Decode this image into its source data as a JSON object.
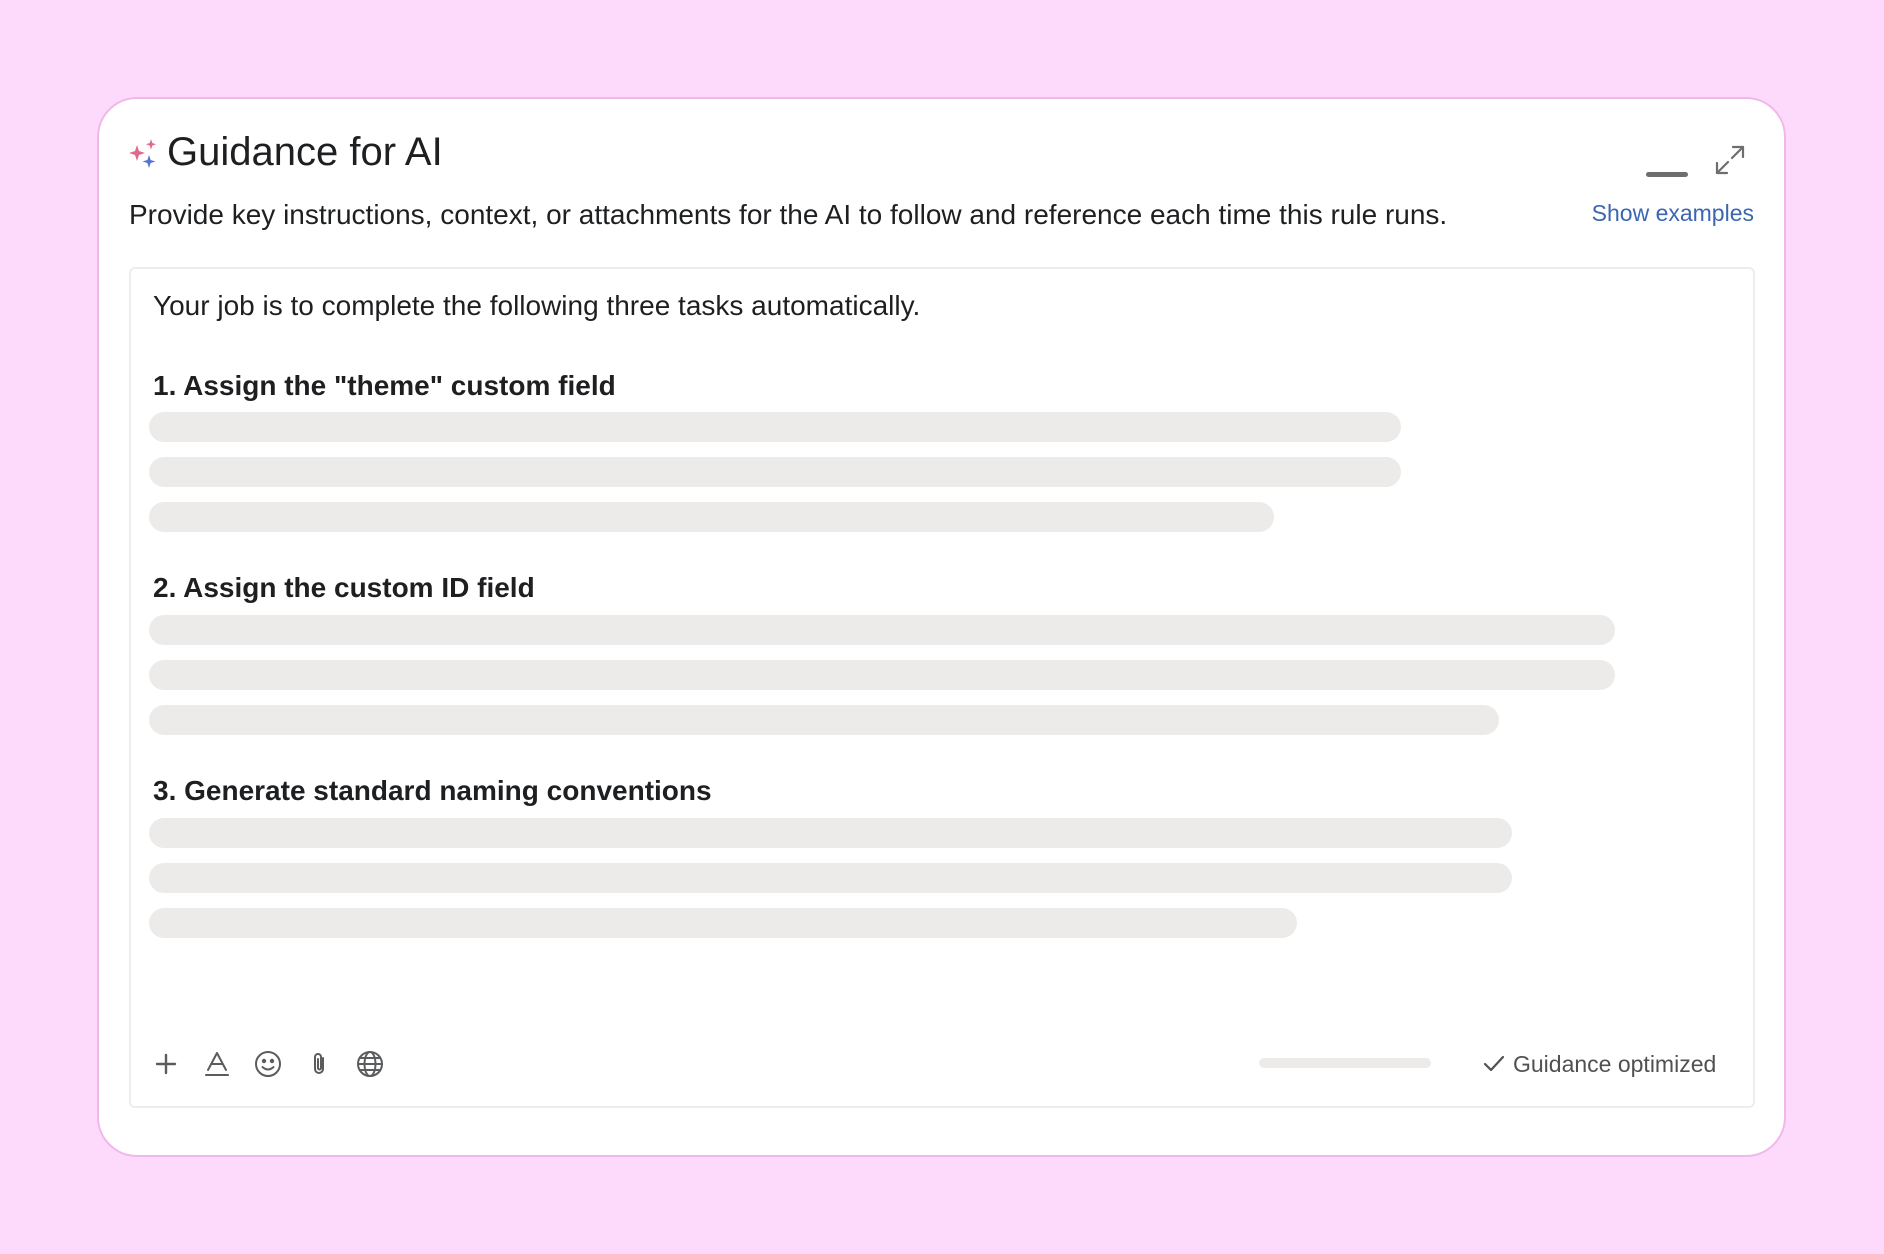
{
  "panel": {
    "title": "Guidance for AI",
    "subtitle": "Provide key instructions, context, or attachments for the AI to follow and reference each time this rule runs.",
    "show_examples_label": "Show examples",
    "header_icon": "sparkles-icon",
    "controls": {
      "minimize_icon": "minimize-icon",
      "expand_icon": "expand-icon"
    }
  },
  "editor": {
    "intro": "Your job is to complete the following three tasks automatically.",
    "sections": [
      {
        "heading": "1. Assign the \"theme\" custom field"
      },
      {
        "heading": "2. Assign the custom ID field"
      },
      {
        "heading": "3. Generate standard naming conventions"
      }
    ],
    "toolbar": [
      "plus-icon",
      "text-format-icon",
      "emoji-icon",
      "attachment-icon",
      "globe-icon"
    ],
    "status": "Guidance optimized",
    "status_icon": "checkmark-icon"
  },
  "colors": {
    "background": "#fdd9fb",
    "link": "#3b66b0",
    "skeleton": "#ecebea",
    "sparkle_pink": "#e06a8e",
    "sparkle_blue": "#5a6fd6"
  }
}
